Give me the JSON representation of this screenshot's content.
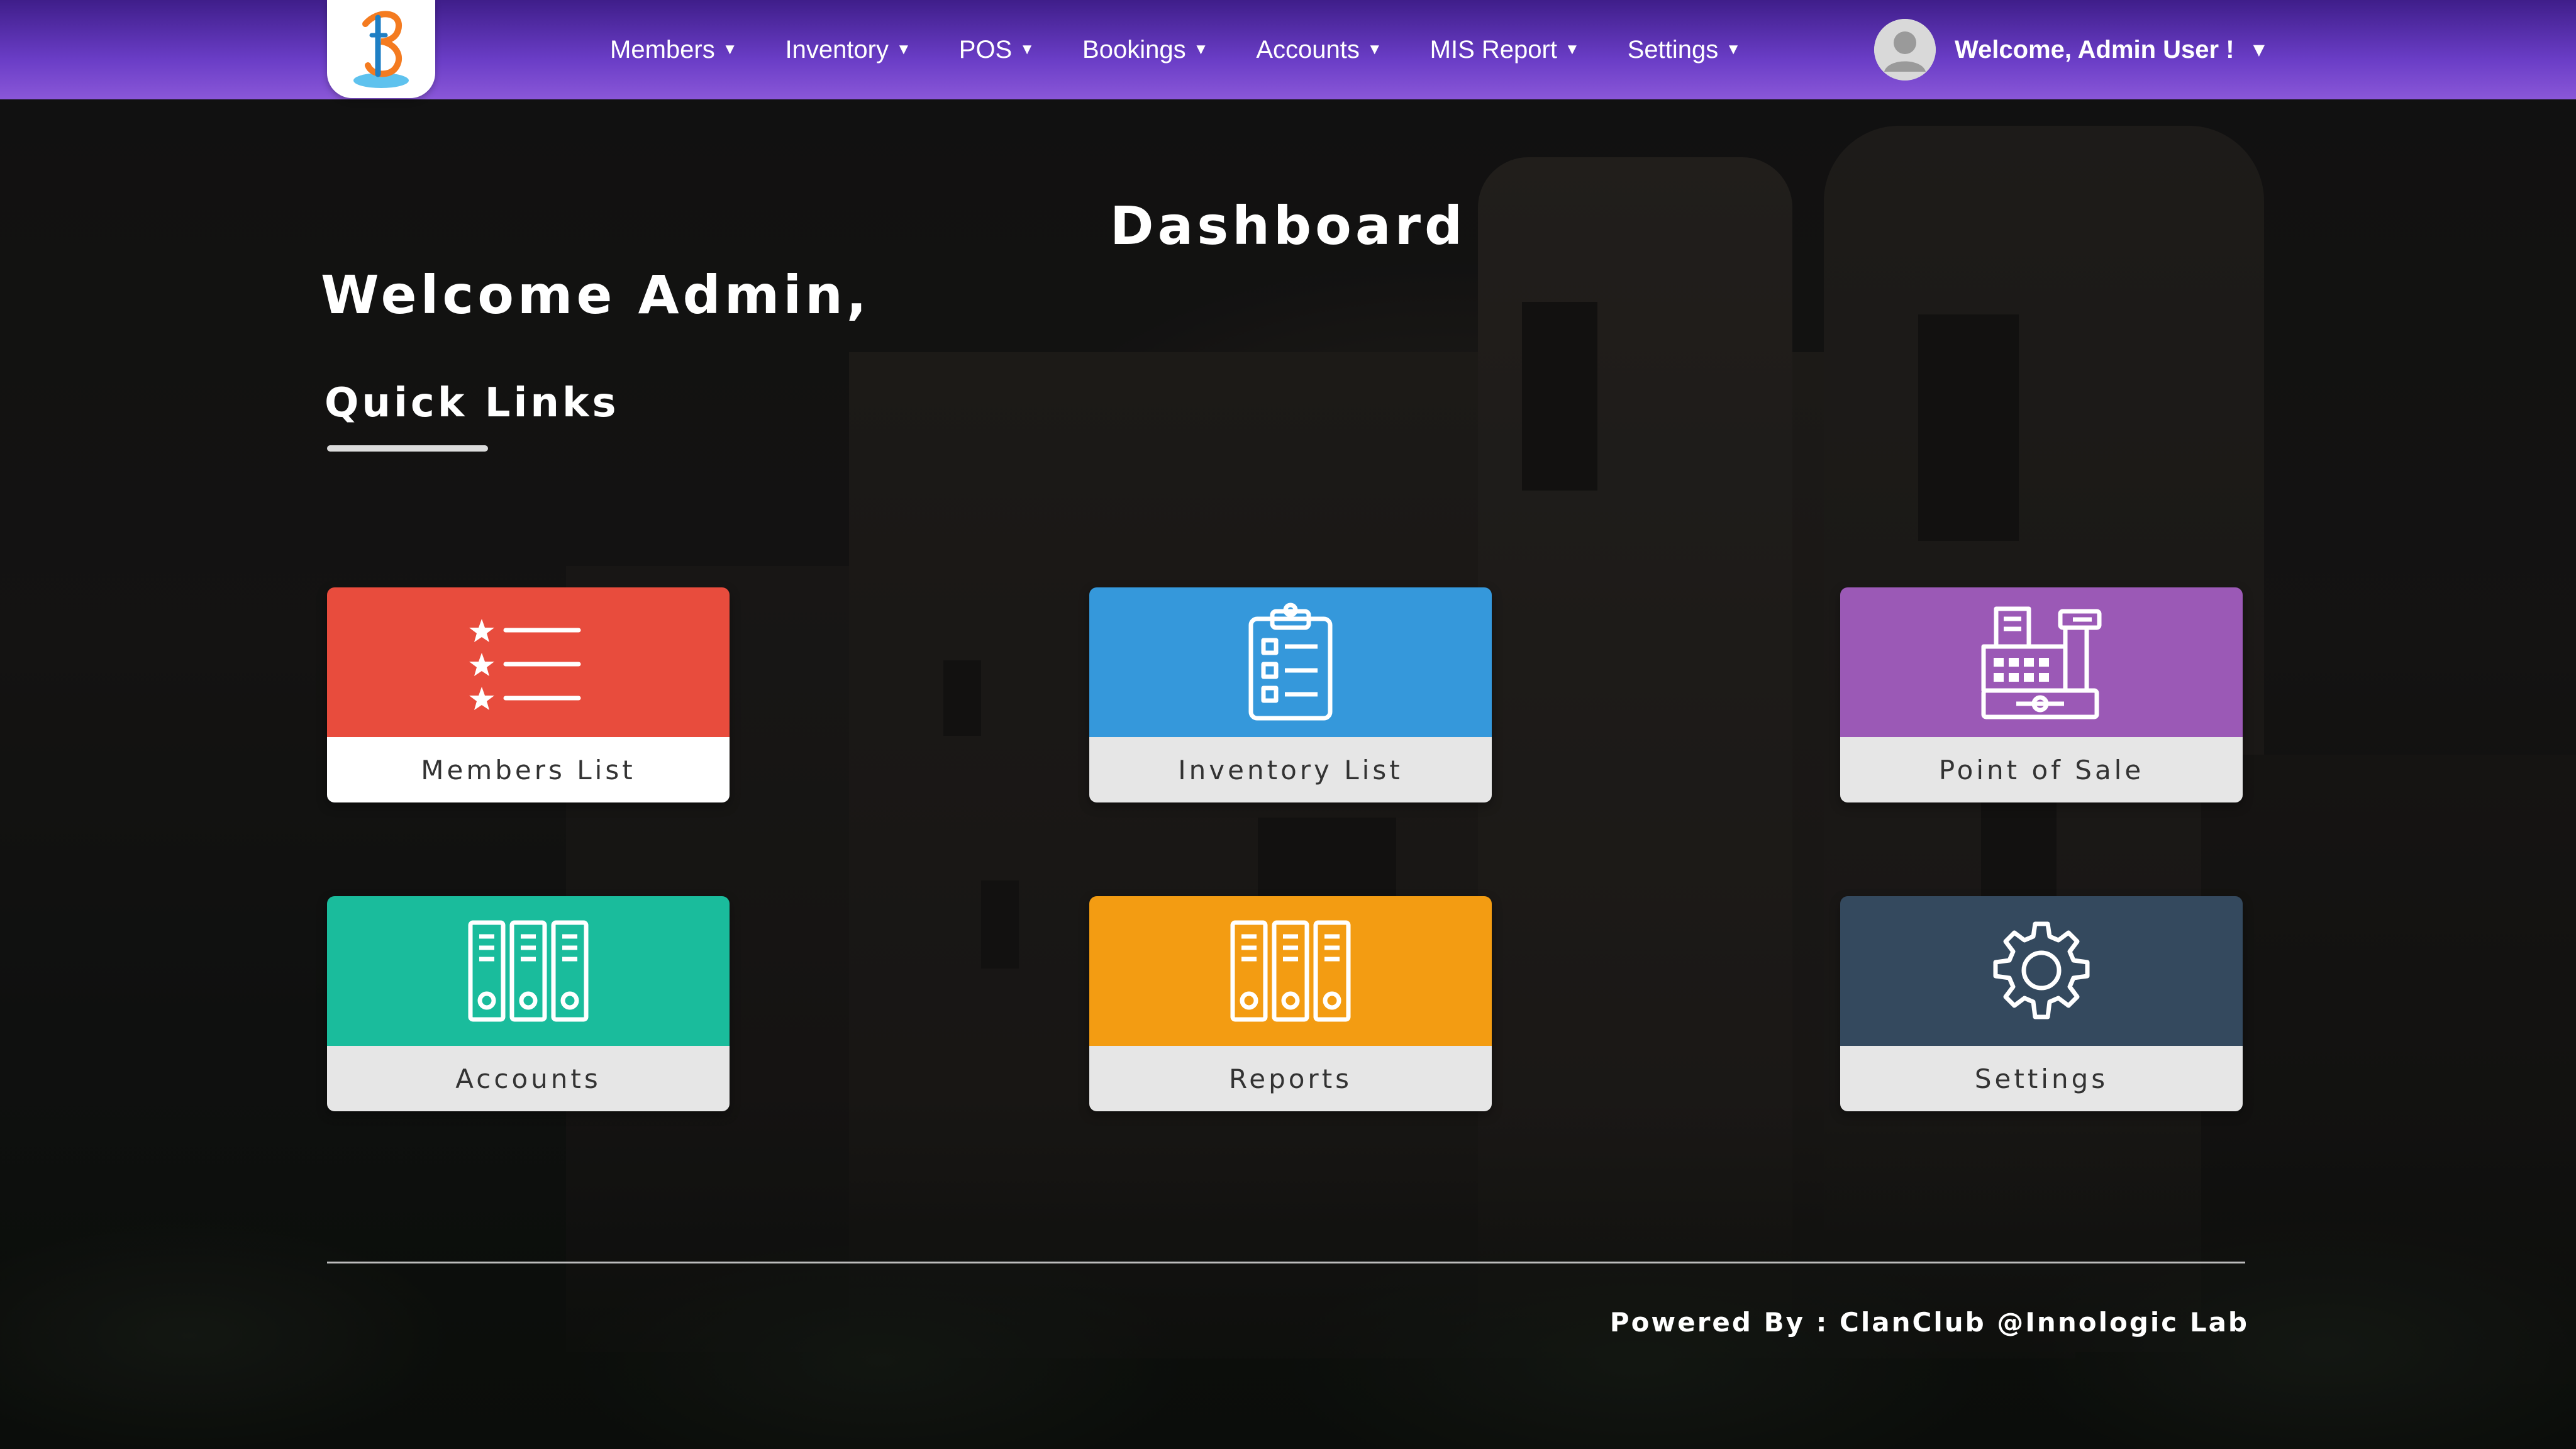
{
  "colors": {
    "nav_gradient_top": "#3f1e8a",
    "nav_gradient_bottom": "#8a57d8",
    "members": "#e84c3d",
    "inventory": "#3598db",
    "pos": "#9b59b6",
    "accounts": "#1abc9c",
    "reports": "#f39c12",
    "settings": "#34495e"
  },
  "nav": {
    "items": [
      {
        "label": "Members"
      },
      {
        "label": "Inventory"
      },
      {
        "label": "POS"
      },
      {
        "label": "Bookings"
      },
      {
        "label": "Accounts"
      },
      {
        "label": "MIS Report"
      },
      {
        "label": "Settings"
      }
    ],
    "user": {
      "label": "Welcome, Admin User !"
    }
  },
  "page": {
    "title": "Dashboard",
    "welcome": "Welcome Admin,",
    "quick_links_heading": "Quick Links"
  },
  "tiles": [
    {
      "label": "Members List",
      "icon": "star-list-icon"
    },
    {
      "label": "Inventory List",
      "icon": "clipboard-list-icon"
    },
    {
      "label": "Point of Sale",
      "icon": "cash-register-icon"
    },
    {
      "label": "Accounts",
      "icon": "binders-icon"
    },
    {
      "label": "Reports",
      "icon": "binders-icon"
    },
    {
      "label": "Settings",
      "icon": "gear-icon"
    }
  ],
  "footer": {
    "powered_by": "Powered By : ClanClub @Innologic Lab"
  }
}
